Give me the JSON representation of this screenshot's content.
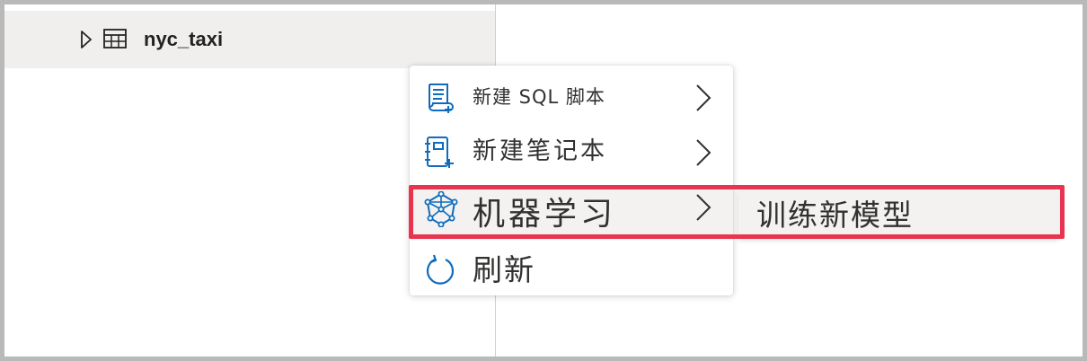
{
  "tree": {
    "item_label": "nyc_taxi",
    "item_icon": "table-icon",
    "expander_icon": "chevron-right-outline-icon"
  },
  "context_menu": {
    "items": [
      {
        "label": "新建 SQL 脚本",
        "icon": "sql-script-icon",
        "has_submenu": true
      },
      {
        "label": "新建笔记本",
        "icon": "notebook-icon",
        "has_submenu": true
      },
      {
        "label": "机器学习",
        "icon": "machine-learning-icon",
        "has_submenu": true
      },
      {
        "label": "刷新",
        "icon": "refresh-icon",
        "has_submenu": false
      }
    ]
  },
  "submenu": {
    "items": [
      {
        "label": "训练新模型"
      }
    ]
  },
  "colors": {
    "accent_blue": "#0f6cbd",
    "highlight_red": "#e8344e",
    "selected_row_bg": "#f0efee",
    "hover_bg": "#f3f2f1",
    "text": "#323130"
  }
}
